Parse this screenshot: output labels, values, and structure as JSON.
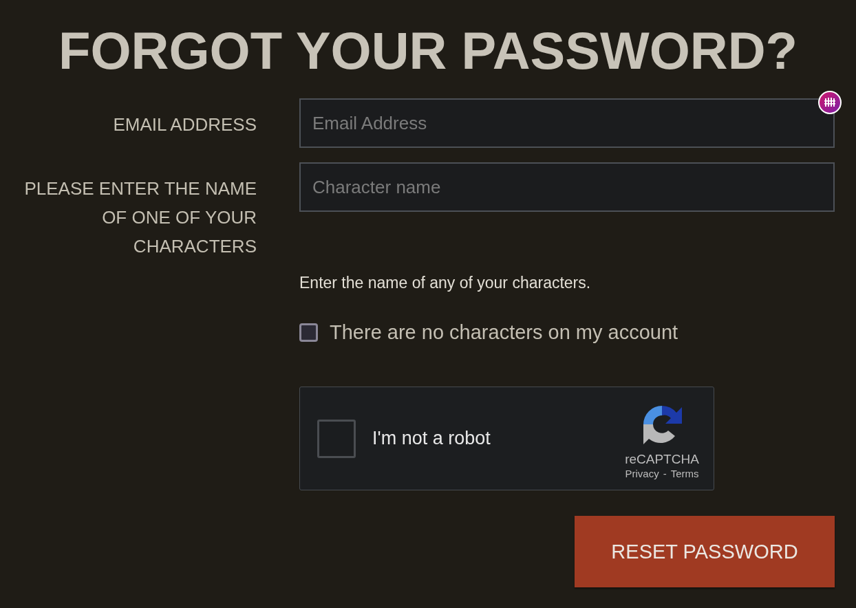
{
  "title": "FORGOT YOUR PASSWORD?",
  "fields": [
    {
      "label": "EMAIL ADDRESS",
      "placeholder": "Email Address",
      "extension_badge": true
    },
    {
      "label": "PLEASE ENTER THE NAME OF ONE OF YOUR CHARACTERS",
      "placeholder": "Character name",
      "extension_badge": false
    }
  ],
  "hint": "Enter the name of any of your characters.",
  "no_characters_checkbox": {
    "label": "There are no characters on my account",
    "checked": false
  },
  "captcha": {
    "label": "I'm not a robot",
    "checked": false,
    "brand": "reCAPTCHA",
    "links": [
      "Privacy",
      "Terms"
    ],
    "separator": "-"
  },
  "submit_button": "RESET PASSWORD"
}
